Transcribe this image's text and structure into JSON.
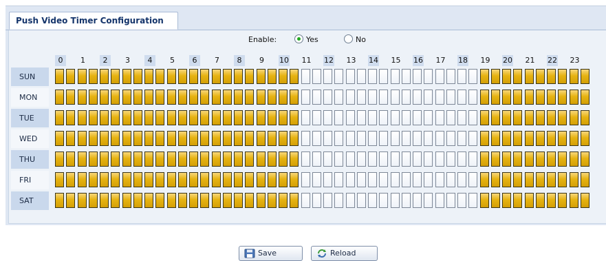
{
  "tab": {
    "label": "Push Video Timer Configuration"
  },
  "enable": {
    "label": "Enable:",
    "yes_label": "Yes",
    "no_label": "No",
    "selected": "Yes"
  },
  "hours": [
    "0",
    "1",
    "2",
    "3",
    "4",
    "5",
    "6",
    "7",
    "8",
    "9",
    "10",
    "11",
    "12",
    "13",
    "14",
    "15",
    "16",
    "17",
    "18",
    "19",
    "20",
    "21",
    "22",
    "23"
  ],
  "days": [
    "SUN",
    "MON",
    "TUE",
    "WED",
    "THU",
    "FRI",
    "SAT"
  ],
  "schedule": {
    "enabled_hours": [
      0,
      1,
      2,
      3,
      4,
      5,
      6,
      7,
      8,
      9,
      10,
      19,
      20,
      21,
      22,
      23
    ],
    "cells_per_hour": 2
  },
  "buttons": {
    "save_label": "Save",
    "reload_label": "Reload"
  },
  "colors": {
    "active": "#e6b312",
    "inactive": "#eef2f8",
    "accent": "#15356b"
  }
}
